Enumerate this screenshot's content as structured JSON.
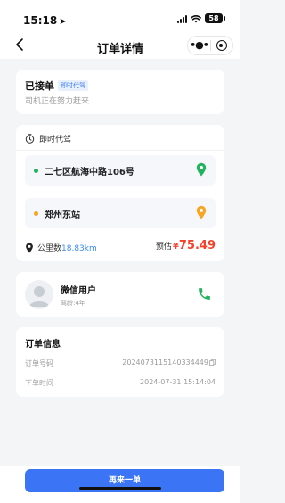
{
  "status_bar": {
    "time": "15:18",
    "battery": "58"
  },
  "nav": {
    "title": "订单详情",
    "more_icon": "more-dots-icon",
    "close_icon": "target-close-icon"
  },
  "order_status": {
    "title": "已接单",
    "badge": "即时代驾",
    "subtitle": "司机正在努力赶来"
  },
  "trip": {
    "type_label": "即时代驾",
    "start": {
      "name": "二七区航海中路106号",
      "dot_color": "#22b35e"
    },
    "end": {
      "name": "郑州东站",
      "dot_color": "#f6a623"
    },
    "distance_label": "公里数",
    "distance_value": "18.83km",
    "price_label": "预估",
    "price_currency": "¥",
    "price_amount": "75.49"
  },
  "driver": {
    "name": "微信用户",
    "experience": "驾龄:4年"
  },
  "order_info": {
    "title": "订单信息",
    "number_label": "订单号码",
    "number_value": "2024073115140334449",
    "time_label": "下单时间",
    "time_value": "2024-07-31 15:14:04"
  },
  "actions": {
    "reorder_label": "再来一单"
  },
  "colors": {
    "accent": "#3b74f5",
    "price": "#f5412b",
    "start_pin": "#22b35e",
    "end_pin": "#f6a623",
    "phone": "#22b35e"
  }
}
